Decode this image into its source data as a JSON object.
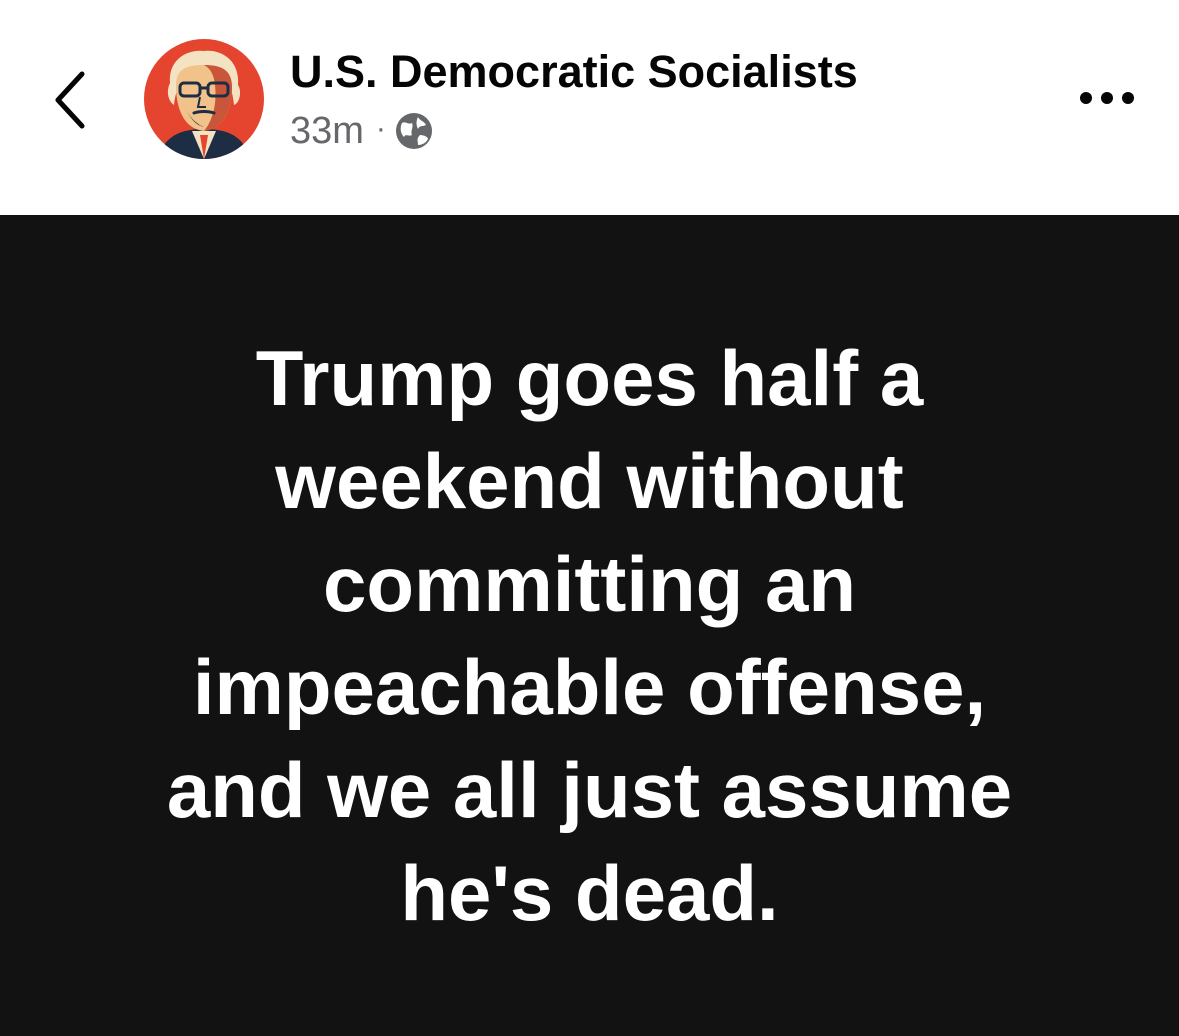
{
  "header": {
    "back_icon": "chevron-left-icon",
    "page_name": "U.S. Democratic Socialists",
    "timestamp": "33m",
    "separator": "·",
    "audience_icon": "globe-icon",
    "more_icon": "more-horizontal-icon"
  },
  "post": {
    "lines": [
      "Trump goes half a",
      "weekend without",
      "committing an",
      "impeachable offense,",
      "and we all just assume",
      "he's dead."
    ],
    "background_color": "#121212",
    "text_color": "#ffffff"
  },
  "colors": {
    "avatar_background": "#e5442f",
    "meta_text": "#65676b"
  }
}
